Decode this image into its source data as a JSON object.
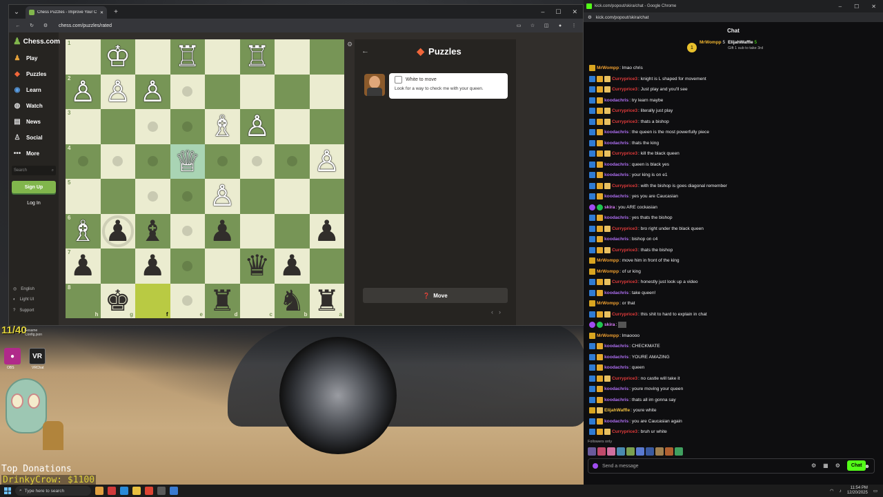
{
  "browser": {
    "tab_title": "Chess Puzzles - Improve Your C",
    "url": "chess.com/puzzles/rated"
  },
  "sidebar": {
    "logo": "Chess.com",
    "items": [
      {
        "label": "Play",
        "icon": "play-icon"
      },
      {
        "label": "Puzzles",
        "icon": "puzzle-icon"
      },
      {
        "label": "Learn",
        "icon": "learn-icon"
      },
      {
        "label": "Watch",
        "icon": "watch-icon"
      },
      {
        "label": "News",
        "icon": "news-icon"
      },
      {
        "label": "Social",
        "icon": "social-icon"
      },
      {
        "label": "More",
        "icon": "more-icon"
      }
    ],
    "search_placeholder": "Search",
    "signup": "Sign Up",
    "login": "Log In",
    "footer": [
      "English",
      "Light UI",
      "Support"
    ]
  },
  "board": {
    "ranks": [
      "1",
      "2",
      "3",
      "4",
      "5",
      "6",
      "7",
      "8"
    ],
    "files": [
      "h",
      "g",
      "f",
      "e",
      "d",
      "c",
      "b",
      "a"
    ],
    "pieces": [
      [
        "",
        "♔",
        "",
        "♖",
        "",
        "♖",
        "",
        ""
      ],
      [
        "♙",
        "♙",
        "♙",
        "",
        "",
        "",
        "",
        ""
      ],
      [
        "",
        "",
        "",
        "",
        "♗",
        "♙",
        "",
        ""
      ],
      [
        "",
        "",
        "",
        "♕",
        "",
        "",
        "",
        "♙"
      ],
      [
        "",
        "",
        "",
        "",
        "♙",
        "",
        "",
        ""
      ],
      [
        "♗",
        "♟",
        "♝",
        "",
        "♟",
        "",
        "",
        "♟"
      ],
      [
        "♟",
        "",
        "♟",
        "",
        "",
        "♛",
        "♟",
        ""
      ],
      [
        "",
        "♚",
        "",
        "",
        "♜",
        "",
        "♞",
        "♜"
      ]
    ],
    "colors": [
      [
        "w",
        "w",
        "w",
        "w",
        "w",
        "w",
        "w",
        "w"
      ],
      [
        "w",
        "w",
        "w",
        "w",
        "w",
        "w",
        "w",
        "w"
      ],
      [
        "w",
        "w",
        "w",
        "w",
        "w",
        "w",
        "w",
        "w"
      ],
      [
        "w",
        "w",
        "w",
        "w",
        "w",
        "w",
        "w",
        "w"
      ],
      [
        "w",
        "w",
        "w",
        "w",
        "w",
        "w",
        "w",
        "w"
      ],
      [
        "w",
        "b",
        "b",
        "w",
        "b",
        "w",
        "w",
        "b"
      ],
      [
        "b",
        "w",
        "b",
        "w",
        "w",
        "b",
        "b",
        "w"
      ],
      [
        "w",
        "b",
        "w",
        "w",
        "b",
        "w",
        "b",
        "b"
      ]
    ],
    "hints": [
      [
        "",
        "",
        "",
        "",
        "",
        "",
        "",
        ""
      ],
      [
        "",
        "",
        "",
        "dot",
        "",
        "",
        "",
        ""
      ],
      [
        "",
        "",
        "dot",
        "dot",
        "",
        "",
        "",
        ""
      ],
      [
        "dot",
        "dot",
        "dot",
        "",
        "dot",
        "dot",
        "dot",
        ""
      ],
      [
        "",
        "",
        "dot",
        "dot",
        "",
        "",
        "",
        ""
      ],
      [
        "",
        "ring",
        "",
        "dot",
        "",
        "",
        "",
        ""
      ],
      [
        "",
        "",
        "",
        "dot",
        "",
        "",
        "",
        ""
      ],
      [
        "",
        "",
        "",
        "dot",
        "",
        "",
        "",
        ""
      ]
    ],
    "highlight_queen": [
      3,
      3
    ],
    "highlight_yellow": [
      7,
      2
    ]
  },
  "puzzle": {
    "title": "Puzzles",
    "to_move": "White to move",
    "hint": "Look for a way to check me with your queen.",
    "move_button": "Move"
  },
  "desktop": {
    "counter": "11/40",
    "counter_sub": "Sesame Config.json",
    "icons": [
      {
        "label": "OBS"
      },
      {
        "label": "VR",
        "sub": "VRChat"
      }
    ],
    "donations_title": "Top Donations",
    "donation": "DrinkyCrow: $1100"
  },
  "chat_window": {
    "title": "kick.com/popout/skira/chat - Google Chrome",
    "url": "kick.com/popout/skira/chat",
    "header": "Chat",
    "pinned": {
      "rank": "1",
      "user1": "MrWompp",
      "count1": "5",
      "user2": "ElijahWaffle",
      "count2": "5",
      "gift": "Gift 1 sub to take 3rd"
    },
    "messages": [
      {
        "u": "MrWompp",
        "c": "orange",
        "b": [
          "crown"
        ],
        "t": ": lmao chris"
      },
      {
        "u": "Curryprice3",
        "c": "red",
        "b": [
          "blue",
          "gold",
          "gift"
        ],
        "t": ": knight is L shaped for movement"
      },
      {
        "u": "Curryprice3",
        "c": "red",
        "b": [
          "blue",
          "gold",
          "gift"
        ],
        "t": ": Just play and you'll see"
      },
      {
        "u": "koodachris",
        "c": "purple",
        "b": [
          "blue",
          "gold"
        ],
        "t": ": try learn maybe"
      },
      {
        "u": "Curryprice3",
        "c": "red",
        "b": [
          "blue",
          "gold",
          "gift"
        ],
        "t": ": literally just play"
      },
      {
        "u": "Curryprice3",
        "c": "red",
        "b": [
          "blue",
          "gold",
          "gift"
        ],
        "t": ": thats a bishop"
      },
      {
        "u": "koodachris",
        "c": "purple",
        "b": [
          "blue",
          "gold"
        ],
        "t": ": the queen is the most powerfully piece"
      },
      {
        "u": "koodachris",
        "c": "purple",
        "b": [
          "blue",
          "gold"
        ],
        "t": ": thats the king"
      },
      {
        "u": "Curryprice3",
        "c": "red",
        "b": [
          "blue",
          "gold",
          "gift"
        ],
        "t": ": kill the black queen"
      },
      {
        "u": "koodachris",
        "c": "purple",
        "b": [
          "blue",
          "gold"
        ],
        "t": ": queen is black yes"
      },
      {
        "u": "koodachris",
        "c": "purple",
        "b": [
          "blue",
          "gold"
        ],
        "t": ": your king is on e1"
      },
      {
        "u": "Curryprice3",
        "c": "red",
        "b": [
          "blue",
          "gold",
          "gift"
        ],
        "t": ": with the bishop is goes diagonal remember"
      },
      {
        "u": "koodachris",
        "c": "purple",
        "b": [
          "blue",
          "gold"
        ],
        "t": ": yes you are Caucasian"
      },
      {
        "u": "skira",
        "c": "pink",
        "b": [
          "purple",
          "green"
        ],
        "t": ": you ARE cockasian"
      },
      {
        "u": "koodachris",
        "c": "purple",
        "b": [
          "blue",
          "gold"
        ],
        "t": ": yes thats the bishop"
      },
      {
        "u": "Curryprice3",
        "c": "red",
        "b": [
          "blue",
          "gold",
          "gift"
        ],
        "t": ": bro right under the black queen"
      },
      {
        "u": "koodachris",
        "c": "purple",
        "b": [
          "blue",
          "gold"
        ],
        "t": ": bishop on c4"
      },
      {
        "u": "Curryprice3",
        "c": "red",
        "b": [
          "blue",
          "gold",
          "gift"
        ],
        "t": ": thats the bishop"
      },
      {
        "u": "MrWompp",
        "c": "orange",
        "b": [
          "crown"
        ],
        "t": ": move him in front of the king"
      },
      {
        "u": "MrWompp",
        "c": "orange",
        "b": [
          "crown"
        ],
        "t": ": of ur king"
      },
      {
        "u": "Curryprice3",
        "c": "red",
        "b": [
          "blue",
          "gold",
          "gift"
        ],
        "t": ": honestly just look up a video"
      },
      {
        "u": "koodachris",
        "c": "purple",
        "b": [
          "blue",
          "gold"
        ],
        "t": ": take queen!"
      },
      {
        "u": "MrWompp",
        "c": "orange",
        "b": [
          "crown"
        ],
        "t": ": or that"
      },
      {
        "u": "Curryprice3",
        "c": "red",
        "b": [
          "blue",
          "gold",
          "gift"
        ],
        "t": ": this shit to hard to explain in chat"
      },
      {
        "u": "skira",
        "c": "pink",
        "b": [
          "purple",
          "green"
        ],
        "t": ":",
        "emote": true
      },
      {
        "u": "MrWompp",
        "c": "orange",
        "b": [
          "crown"
        ],
        "t": ": lmaoooo"
      },
      {
        "u": "koodachris",
        "c": "purple",
        "b": [
          "blue",
          "gold"
        ],
        "t": ": CHECKMATE"
      },
      {
        "u": "koodachris",
        "c": "purple",
        "b": [
          "blue",
          "gold"
        ],
        "t": ": YOURE AMAZING"
      },
      {
        "u": "koodachris",
        "c": "purple",
        "b": [
          "blue",
          "gold"
        ],
        "t": ": queen"
      },
      {
        "u": "Curryprice3",
        "c": "red",
        "b": [
          "blue",
          "gold",
          "gift"
        ],
        "t": ": no castle will take it"
      },
      {
        "u": "koodachris",
        "c": "purple",
        "b": [
          "blue",
          "gold"
        ],
        "t": ": youre moving your queen"
      },
      {
        "u": "koodachris",
        "c": "purple",
        "b": [
          "blue",
          "gold"
        ],
        "t": ": thats all im gonna say"
      },
      {
        "u": "ElijahWaffle",
        "c": "gold",
        "b": [
          "crown",
          "gift"
        ],
        "t": ": youre white"
      },
      {
        "u": "koodachris",
        "c": "purple",
        "b": [
          "blue",
          "gold"
        ],
        "t": ": you are Caucasian again"
      },
      {
        "u": "Curryprice3",
        "c": "red",
        "b": [
          "blue",
          "gold",
          "gift"
        ],
        "t": ": bruh ur white"
      }
    ],
    "followers_only": "Followers only",
    "send_placeholder": "Send a message",
    "chat_button": "Chat"
  },
  "taskbar": {
    "search_placeholder": "Type here to search",
    "time": "11:54 PM",
    "date": "12/20/2025"
  }
}
